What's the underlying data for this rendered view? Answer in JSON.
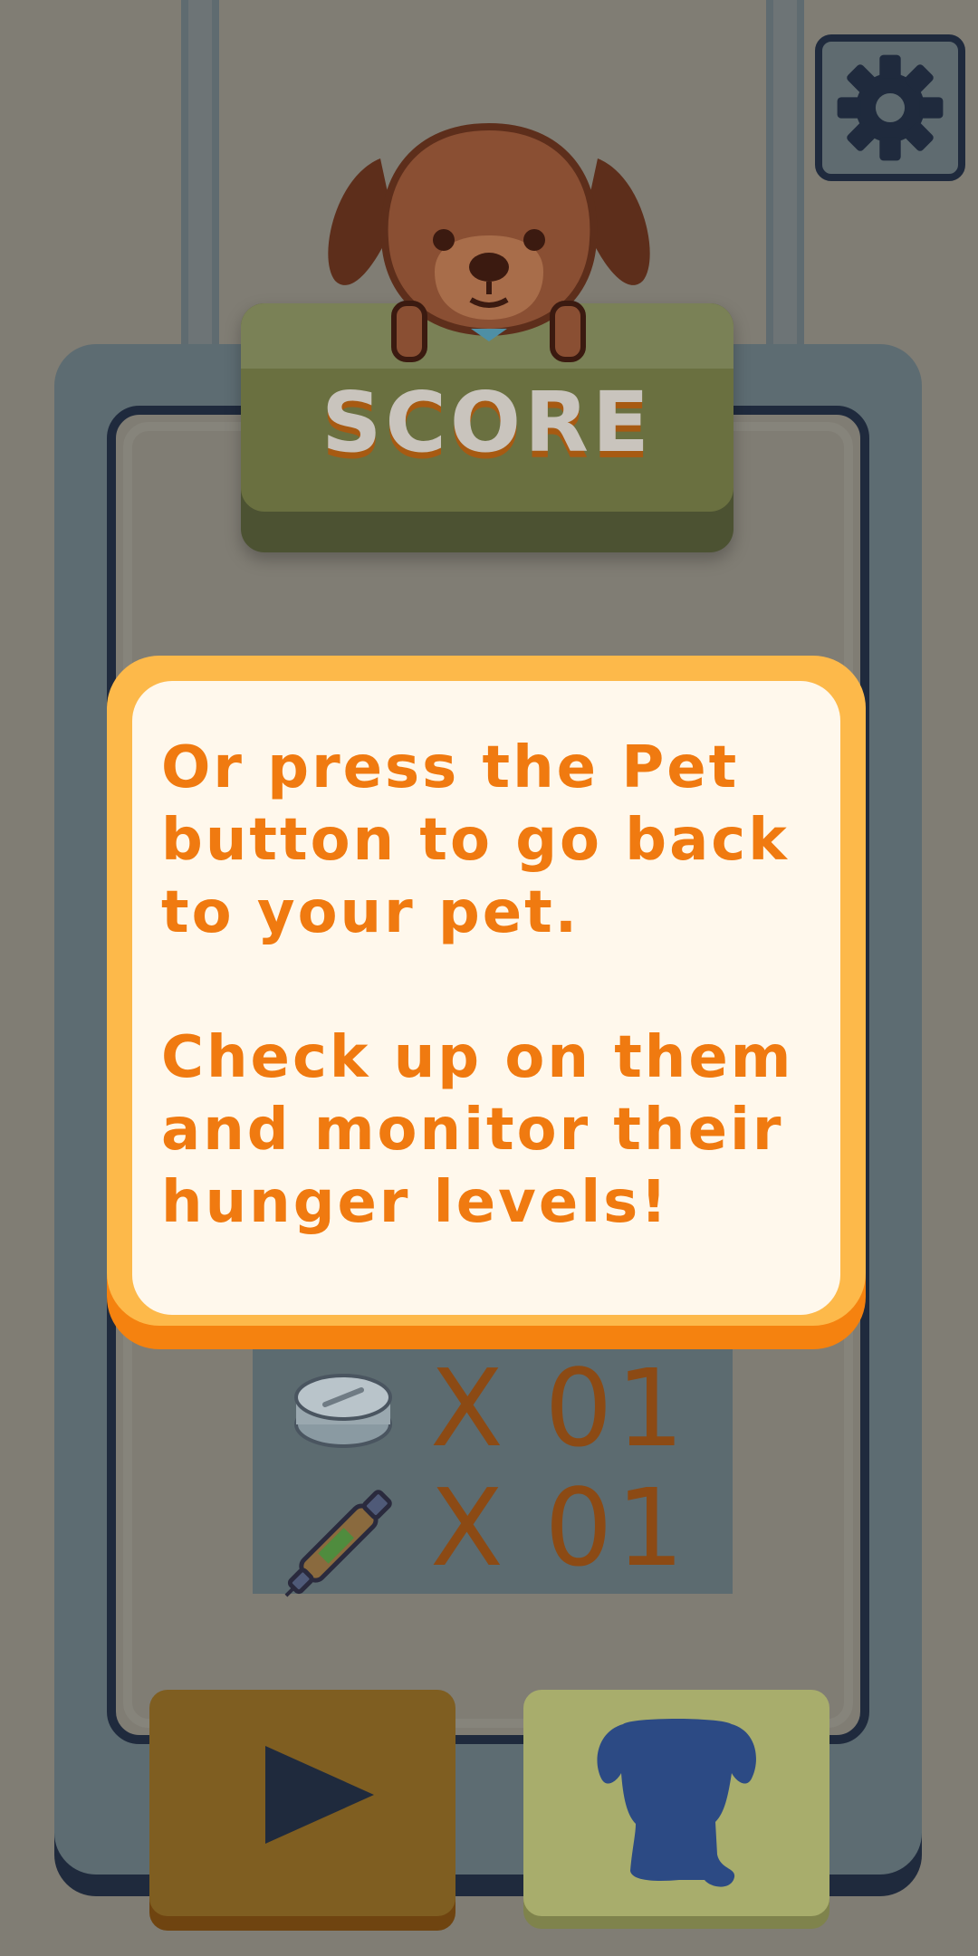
{
  "score": {
    "title": "SCORE"
  },
  "dialog": {
    "message": "Or press the Pet\nbutton to go back\nto your pet.\n\nCheck up on them\nand monitor their\nhunger levels!"
  },
  "items": [
    {
      "icon": "pill-jar-icon",
      "count": "X 01"
    },
    {
      "icon": "syringe-icon",
      "count": "X 01"
    }
  ],
  "buttons": {
    "play_icon": "play-icon",
    "pet_icon": "dog-silhouette-icon",
    "settings_icon": "gear-icon"
  },
  "colors": {
    "overlay": "#807d74",
    "dialog_border": "#fdb94a",
    "dialog_text": "#f07a10",
    "item_count": "#8c4a14"
  }
}
